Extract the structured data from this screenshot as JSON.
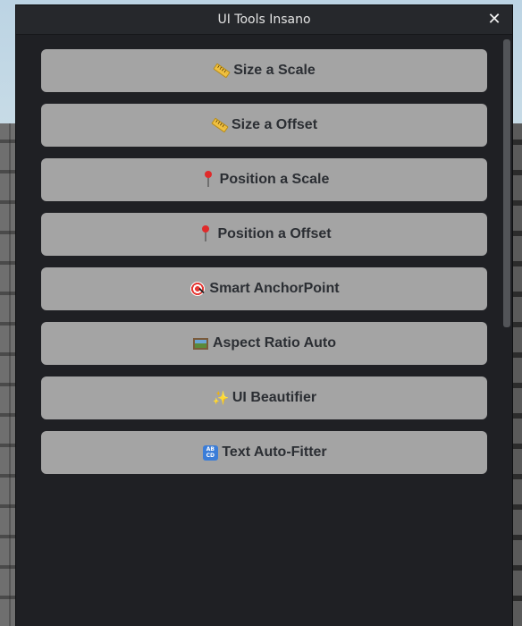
{
  "window": {
    "title": "UI Tools Insano",
    "close_glyph": "✕"
  },
  "buttons": [
    {
      "label": "Size a Scale",
      "icon": "ruler-icon"
    },
    {
      "label": "Size a Offset",
      "icon": "ruler-icon"
    },
    {
      "label": "Position a Scale",
      "icon": "pushpin-icon"
    },
    {
      "label": "Position a Offset",
      "icon": "pushpin-icon"
    },
    {
      "label": "Smart AnchorPoint",
      "icon": "target-icon"
    },
    {
      "label": "Aspect Ratio Auto",
      "icon": "picture-icon"
    },
    {
      "label": "UI Beautifier",
      "icon": "sparkles-icon"
    },
    {
      "label": "Text Auto-Fitter",
      "icon": "abcd-icon"
    }
  ],
  "colors": {
    "window_bg": "#1f2024",
    "titlebar_bg": "#26282c",
    "button_bg": "#a4a4a4",
    "button_text": "#2b2e33"
  }
}
